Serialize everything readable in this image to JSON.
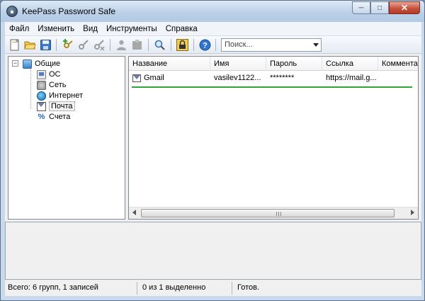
{
  "window": {
    "title": "KeePass Password Safe"
  },
  "menu": [
    "Файл",
    "Изменить",
    "Вид",
    "Инструменты",
    "Справка"
  ],
  "toolbar": {
    "icons": [
      "new-database-icon",
      "open-database-icon",
      "save-icon",
      "add-entry-icon",
      "edit-entry-icon",
      "delete-entry-icon",
      "copy-username-icon",
      "copy-password-icon",
      "find-icon",
      "lock-workspace-icon",
      "help-icon"
    ],
    "search_placeholder": "Поиск..."
  },
  "tree": {
    "root": "Общие",
    "groups": [
      "ОС",
      "Сеть",
      "Интернет",
      "Почта",
      "Счета"
    ],
    "selected": "Почта"
  },
  "list": {
    "columns": [
      "Название",
      "Имя",
      "Пароль",
      "Ссылка",
      "Комментар"
    ],
    "rows": [
      {
        "title": "Gmail",
        "user": "vasilev1122...",
        "password": "********",
        "url": "https://mail.g..."
      }
    ]
  },
  "status": {
    "summary": "Всего: 6 групп, 1 записей",
    "selection": "0 из 1 выделенно",
    "state": "Готов."
  },
  "colors": {
    "title_gradient": "#bcd1e8",
    "close_button": "#c8513d",
    "row_highlight": "#2ea534"
  }
}
